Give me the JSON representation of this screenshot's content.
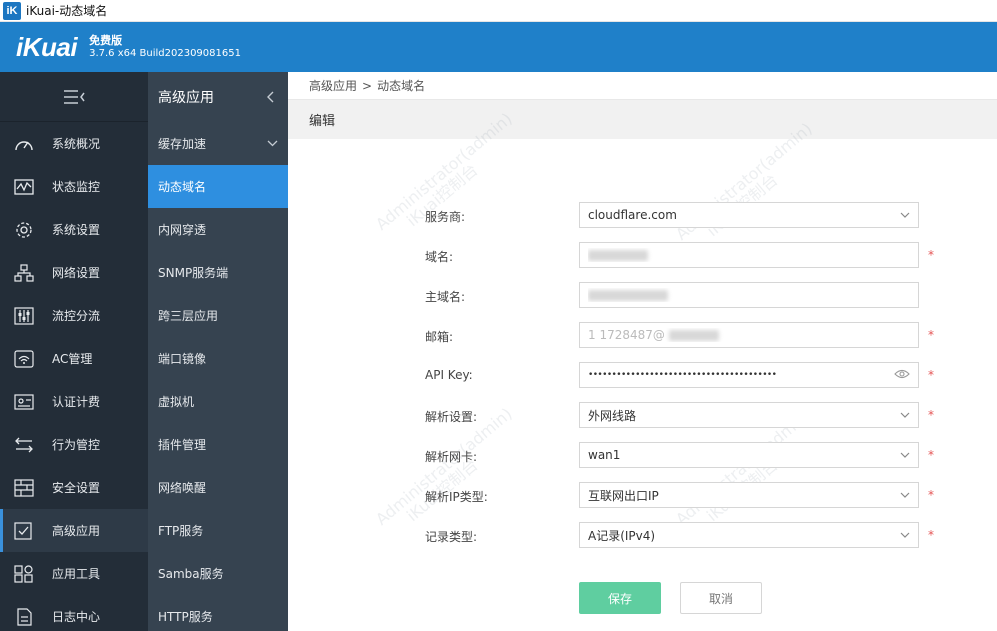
{
  "window": {
    "title": "iKuai-动态域名",
    "app_icon": "iK"
  },
  "header": {
    "logo": "iKuai",
    "edition": "免费版",
    "build": "3.7.6 x64 Build202309081651",
    "bg_color": "#1f80c9"
  },
  "sidebar": {
    "toggle_icon": "menu-collapse-icon",
    "items": [
      {
        "label": "系统概况",
        "icon": "speedometer-icon"
      },
      {
        "label": "状态监控",
        "icon": "monitor-chart-icon"
      },
      {
        "label": "系统设置",
        "icon": "gear-icon"
      },
      {
        "label": "网络设置",
        "icon": "network-tree-icon"
      },
      {
        "label": "流控分流",
        "icon": "sliders-icon"
      },
      {
        "label": "AC管理",
        "icon": "wifi-ap-icon"
      },
      {
        "label": "认证计费",
        "icon": "id-card-icon"
      },
      {
        "label": "行为管控",
        "icon": "swap-arrows-icon"
      },
      {
        "label": "安全设置",
        "icon": "firewall-icon"
      },
      {
        "label": "高级应用",
        "icon": "checklist-icon"
      },
      {
        "label": "应用工具",
        "icon": "apps-grid-icon"
      },
      {
        "label": "日志中心",
        "icon": "document-icon"
      }
    ],
    "active_index": 9
  },
  "submenu": {
    "title": "高级应用",
    "items": [
      {
        "label": "缓存加速"
      },
      {
        "label": "动态域名"
      },
      {
        "label": "内网穿透"
      },
      {
        "label": "SNMP服务端"
      },
      {
        "label": "跨三层应用"
      },
      {
        "label": "端口镜像"
      },
      {
        "label": "虚拟机"
      },
      {
        "label": "插件管理"
      },
      {
        "label": "网络唤醒"
      },
      {
        "label": "FTP服务"
      },
      {
        "label": "Samba服务"
      },
      {
        "label": "HTTP服务"
      }
    ],
    "active_index": 1,
    "active_color": "#2e8fe0"
  },
  "breadcrumb": {
    "parent": "高级应用",
    "separator": ">",
    "current": "动态域名"
  },
  "section_title": "编辑",
  "form": {
    "provider": {
      "label": "服务商:",
      "value": "cloudflare.com"
    },
    "domain": {
      "label": "域名:"
    },
    "host": {
      "label": "主域名:"
    },
    "email": {
      "label": "邮箱:",
      "visible_fragment": "1   1728487@"
    },
    "api_key": {
      "label": "API Key:",
      "value": "••••••••••••••••••••••••••••••••••••••••"
    },
    "resolve": {
      "label": "解析设置:",
      "value": "外网线路"
    },
    "nic": {
      "label": "解析网卡:",
      "value": "wan1"
    },
    "ip_type": {
      "label": "解析IP类型:",
      "value": "互联网出口IP"
    },
    "record": {
      "label": "记录类型:",
      "value": "A记录(IPv4)"
    },
    "required_mark": "*"
  },
  "buttons": {
    "save": "保存",
    "cancel": "取消",
    "save_color": "#5fcea0"
  },
  "watermark": {
    "line1": "Administrator(admin)",
    "line2": "iKuai控制台"
  }
}
